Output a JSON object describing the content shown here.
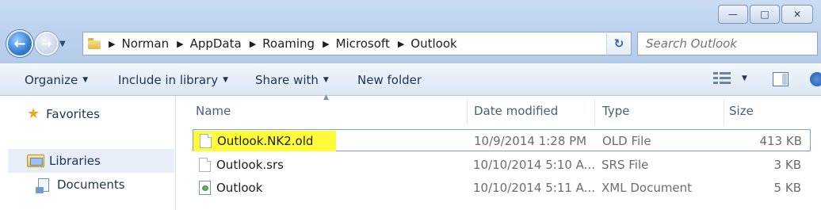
{
  "window": {
    "minimize_glyph": "—",
    "maximize_glyph": "□",
    "close_glyph": "✕"
  },
  "navigation": {
    "back_glyph": "←",
    "forward_glyph": "→",
    "history_glyph": "▼",
    "refresh_glyph": "↻",
    "address_dropdown_glyph": "▼",
    "breadcrumbs": [
      "Norman",
      "AppData",
      "Roaming",
      "Microsoft",
      "Outlook"
    ],
    "separator_glyph": "▶"
  },
  "search": {
    "placeholder": "Search Outlook",
    "value": ""
  },
  "commands": {
    "organize": "Organize",
    "include_in_library": "Include in library",
    "share_with": "Share with",
    "new_folder": "New folder",
    "caret_glyph": "▼"
  },
  "sidebar": {
    "items": [
      {
        "label": "Favorites",
        "icon": "star-icon"
      },
      {
        "label": "Libraries",
        "icon": "library-icon"
      },
      {
        "label": "Documents",
        "icon": "documents-icon"
      }
    ]
  },
  "file_list": {
    "columns": {
      "name": "Name",
      "date_modified": "Date modified",
      "type": "Type",
      "size": "Size"
    },
    "sort_glyph": "▲",
    "rows": [
      {
        "name": "Outlook.NK2.old",
        "date": "10/9/2014 1:28 PM",
        "type": "OLD File",
        "size": "413 KB",
        "icon": "file-icon",
        "highlighted": true
      },
      {
        "name": "Outlook.srs",
        "date": "10/10/2014 5:10 A...",
        "type": "SRS File",
        "size": "3 KB",
        "icon": "file-icon",
        "highlighted": false
      },
      {
        "name": "Outlook",
        "date": "10/10/2014 5:11 A...",
        "type": "XML Document",
        "size": "5 KB",
        "icon": "xml-document-icon",
        "highlighted": false
      }
    ]
  },
  "colors": {
    "highlight": "#fefb3a",
    "frame": "#bdd3ee",
    "command_text": "#1e3457"
  }
}
